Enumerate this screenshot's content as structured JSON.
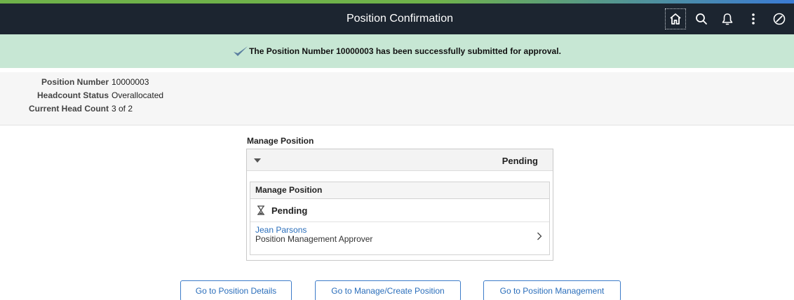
{
  "header": {
    "title": "Position Confirmation",
    "icons": [
      "home-icon",
      "search-icon",
      "bell-icon",
      "more-vertical-icon",
      "navbar-compass-icon"
    ]
  },
  "message": {
    "icon": "checkmark-icon",
    "text": "The Position Number 10000003 has been successfully submitted for approval."
  },
  "summary": {
    "rows": [
      {
        "label": "Position Number",
        "value": "10000003"
      },
      {
        "label": "Headcount Status",
        "value": "Overallocated"
      },
      {
        "label": "Current Head Count",
        "value": "3 of 2"
      }
    ]
  },
  "approval": {
    "heading": "Manage Position",
    "status": "Pending",
    "step": {
      "title": "Manage Position",
      "status": "Pending",
      "approver_name": "Jean Parsons",
      "approver_role": "Position Management Approver"
    }
  },
  "buttons": {
    "details": "Go to Position Details",
    "manage_create": "Go to Manage/Create Position",
    "management": "Go to Position Management"
  },
  "colors": {
    "banner": "#1c2530",
    "message_bg": "#c7e7d4",
    "link": "#2a6ebb"
  }
}
